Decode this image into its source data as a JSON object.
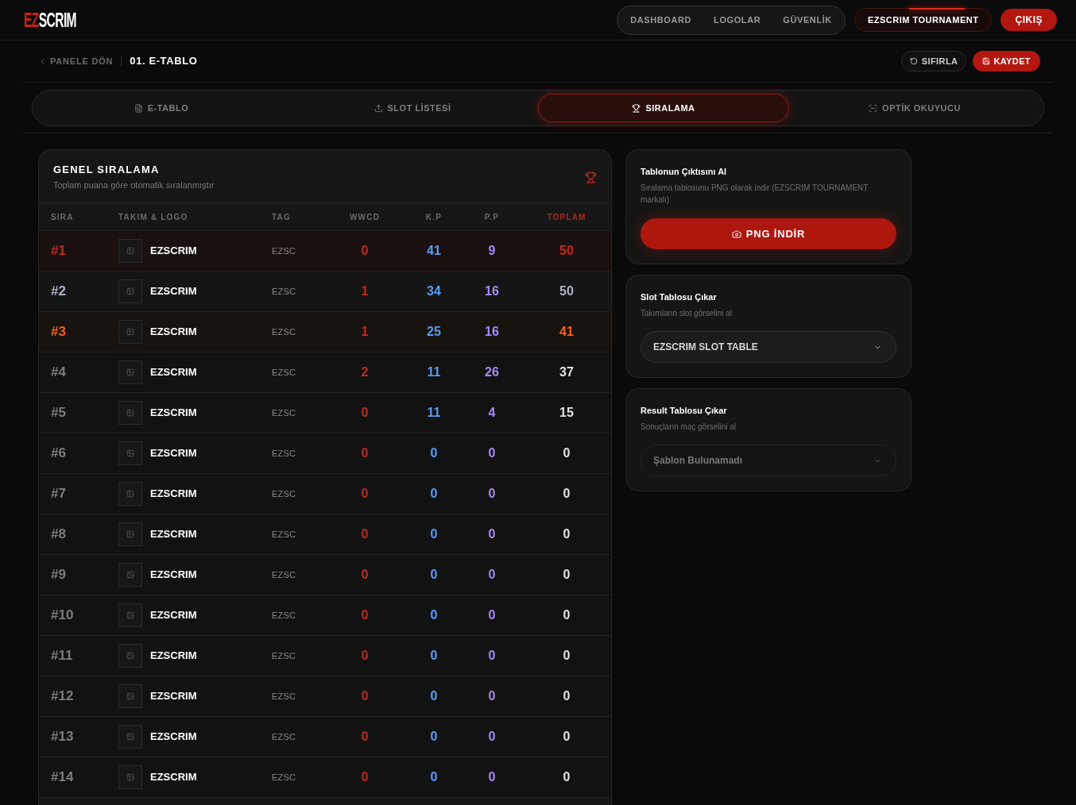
{
  "header": {
    "logo": {
      "accent": "EZ",
      "rest": "SCRIM"
    },
    "nav": [
      {
        "label": "DASHBOARD"
      },
      {
        "label": "LOGOLAR"
      },
      {
        "label": "GÜVENLİK"
      }
    ],
    "tournament_button": "EZSCRIM TOURNAMENT",
    "logout_button": "ÇIKIŞ"
  },
  "toolbar": {
    "back_link": "PANELE DÖN",
    "page_title": "01. E-TABLO",
    "reset_button": "SIFIRLA",
    "save_button": "KAYDET"
  },
  "tabs": [
    {
      "label": "E-TABLO",
      "selected": false
    },
    {
      "label": "SLOT LİSTESİ",
      "selected": false
    },
    {
      "label": "SIRALAMA",
      "selected": true
    },
    {
      "label": "OPTİK OKUYUCU",
      "selected": false
    }
  ],
  "ranking": {
    "title": "GENEL SIRALAMA",
    "subtitle": "Toplam puana göre otomatik sıralanmıştır",
    "columns": [
      "SIRA",
      "TAKIM & LOGO",
      "TAG",
      "WWCD",
      "K.P",
      "P.P",
      "TOPLAM"
    ],
    "rows": [
      {
        "kind": "first",
        "rank": "#1",
        "team": "EZSCRIM",
        "tag": "EZSC",
        "wwcd": "0",
        "kp": "41",
        "pp": "9",
        "total": "50"
      },
      {
        "kind": "second",
        "rank": "#2",
        "team": "EZSCRIM",
        "tag": "EZSC",
        "wwcd": "1",
        "kp": "34",
        "pp": "16",
        "total": "50"
      },
      {
        "kind": "third",
        "rank": "#3",
        "team": "EZSCRIM",
        "tag": "EZSC",
        "wwcd": "1",
        "kp": "25",
        "pp": "16",
        "total": "41"
      },
      {
        "kind": "regular",
        "rank": "#4",
        "team": "EZSCRIM",
        "tag": "EZSC",
        "wwcd": "2",
        "kp": "11",
        "pp": "26",
        "total": "37"
      },
      {
        "kind": "regular",
        "rank": "#5",
        "team": "EZSCRIM",
        "tag": "EZSC",
        "wwcd": "0",
        "kp": "11",
        "pp": "4",
        "total": "15"
      },
      {
        "kind": "regular",
        "rank": "#6",
        "team": "EZSCRIM",
        "tag": "EZSC",
        "wwcd": "0",
        "kp": "0",
        "pp": "0",
        "total": "0"
      },
      {
        "kind": "regular",
        "rank": "#7",
        "team": "EZSCRIM",
        "tag": "EZSC",
        "wwcd": "0",
        "kp": "0",
        "pp": "0",
        "total": "0"
      },
      {
        "kind": "regular",
        "rank": "#8",
        "team": "EZSCRIM",
        "tag": "EZSC",
        "wwcd": "0",
        "kp": "0",
        "pp": "0",
        "total": "0"
      },
      {
        "kind": "regular",
        "rank": "#9",
        "team": "EZSCRIM",
        "tag": "EZSC",
        "wwcd": "0",
        "kp": "0",
        "pp": "0",
        "total": "0"
      },
      {
        "kind": "regular",
        "rank": "#10",
        "team": "EZSCRIM",
        "tag": "EZSC",
        "wwcd": "0",
        "kp": "0",
        "pp": "0",
        "total": "0"
      },
      {
        "kind": "regular",
        "rank": "#11",
        "team": "EZSCRIM",
        "tag": "EZSC",
        "wwcd": "0",
        "kp": "0",
        "pp": "0",
        "total": "0"
      },
      {
        "kind": "regular",
        "rank": "#12",
        "team": "EZSCRIM",
        "tag": "EZSC",
        "wwcd": "0",
        "kp": "0",
        "pp": "0",
        "total": "0"
      },
      {
        "kind": "regular",
        "rank": "#13",
        "team": "EZSCRIM",
        "tag": "EZSC",
        "wwcd": "0",
        "kp": "0",
        "pp": "0",
        "total": "0"
      },
      {
        "kind": "regular",
        "rank": "#14",
        "team": "EZSCRIM",
        "tag": "EZSC",
        "wwcd": "0",
        "kp": "0",
        "pp": "0",
        "total": "0"
      }
    ]
  },
  "export_panels": [
    {
      "kind": "download",
      "title": "Tablonun Çıktısını Al",
      "description": "Sıralama tablosunu PNG olarak indir (EZSCRIM TOURNAMENT markalı)",
      "button": "PNG İNDİR"
    },
    {
      "kind": "select",
      "title": "Slot Tablosu Çıkar",
      "description": "Takımların slot görselini al",
      "select": {
        "value": "EZSCRIM SLOT TABLE",
        "disabled": false
      }
    },
    {
      "kind": "select",
      "title": "Result Tablosu Çıkar",
      "description": "Sonuçların maç görselini al",
      "select": {
        "value": "Şablon Bulunamadı",
        "disabled": true
      }
    }
  ]
}
